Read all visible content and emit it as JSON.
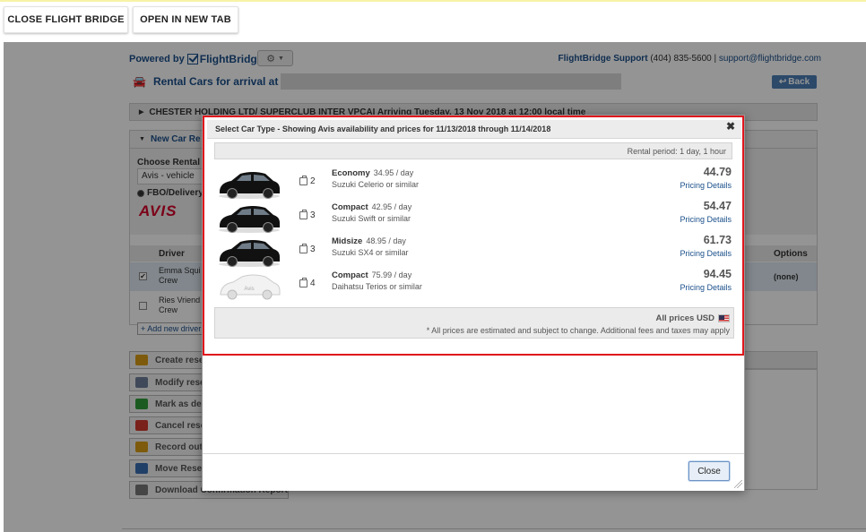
{
  "topbar": {
    "close_flight_bridge": "CLOSE FLIGHT BRIDGE",
    "open_in_new_tab": "OPEN IN NEW TAB"
  },
  "background": {
    "powered_by": "Powered by",
    "logo_text": "FlightBridge",
    "support_label": "FlightBridge Support",
    "support_phone": "(404) 835-5600",
    "support_sep": "|",
    "support_email": "support@flightbridge.com",
    "page_title": "Rental Cars for arrival at",
    "back_label": "Back",
    "trip_bar": "CHESTER HOLDING LTD/ SUPERCLUB INTER   VPCAI   Arriving Tuesday, 13 Nov 2018 at 12:00 local time",
    "panel_title": "New Car Re",
    "choose_rental": "Choose Rental",
    "vendor_select": "Avis - vehicle",
    "fbo_delivery": "FBO/Delivery",
    "vendor_logo": "AVIS",
    "driver_col": "Driver",
    "options_col": "Options",
    "drivers": [
      {
        "name": "Emma Squi",
        "role": "Crew",
        "checked": true
      },
      {
        "name": "Ries Vriend",
        "role": "Crew",
        "checked": false
      }
    ],
    "options_value": "(none)",
    "add_driver": "+ Add new driver",
    "actions": [
      {
        "label": "Create rese",
        "icon": "car-icon",
        "color": "#d89b16"
      },
      {
        "label": "Modify rese",
        "icon": "car-edit-icon",
        "color": "#6d7f99"
      },
      {
        "label": "Mark as de",
        "icon": "check-icon",
        "color": "#2f9e3b"
      },
      {
        "label": "Cancel rese",
        "icon": "cancel-icon",
        "color": "#d23a2f"
      },
      {
        "label": "Record out",
        "icon": "record-icon",
        "color": "#d89b16"
      },
      {
        "label": "Move Rese",
        "icon": "arrow-right-icon",
        "color": "#3a6fb3"
      },
      {
        "label": "Download Confirmation Report",
        "icon": "printer-icon",
        "color": "#777"
      }
    ]
  },
  "modal": {
    "title": "Select Car Type - Showing Avis availability and prices for 11/13/2018 through 11/14/2018",
    "close_x": "✖",
    "rental_period": "Rental period: 1 day, 1 hour",
    "cars": [
      {
        "class": "Economy",
        "rate": "34.95 / day",
        "model": "Suzuki Celerio or similar",
        "bags": "2",
        "price": "44.79",
        "details": "Pricing Details",
        "image": "car-black"
      },
      {
        "class": "Compact",
        "rate": "42.95 / day",
        "model": "Suzuki Swift or similar",
        "bags": "3",
        "price": "54.47",
        "details": "Pricing Details",
        "image": "car-black"
      },
      {
        "class": "Midsize",
        "rate": "48.95 / day",
        "model": "Suzuki SX4 or similar",
        "bags": "3",
        "price": "61.73",
        "details": "Pricing Details",
        "image": "car-black"
      },
      {
        "class": "Compact",
        "rate": "75.99 / day",
        "model": "Daihatsu Terios or similar",
        "bags": "4",
        "price": "94.45",
        "details": "Pricing Details",
        "image": "car-placeholder"
      }
    ],
    "all_prices": "All prices USD",
    "disclaimer": "* All prices are estimated and subject to change. Additional fees and taxes may apply",
    "close_button": "Close"
  }
}
